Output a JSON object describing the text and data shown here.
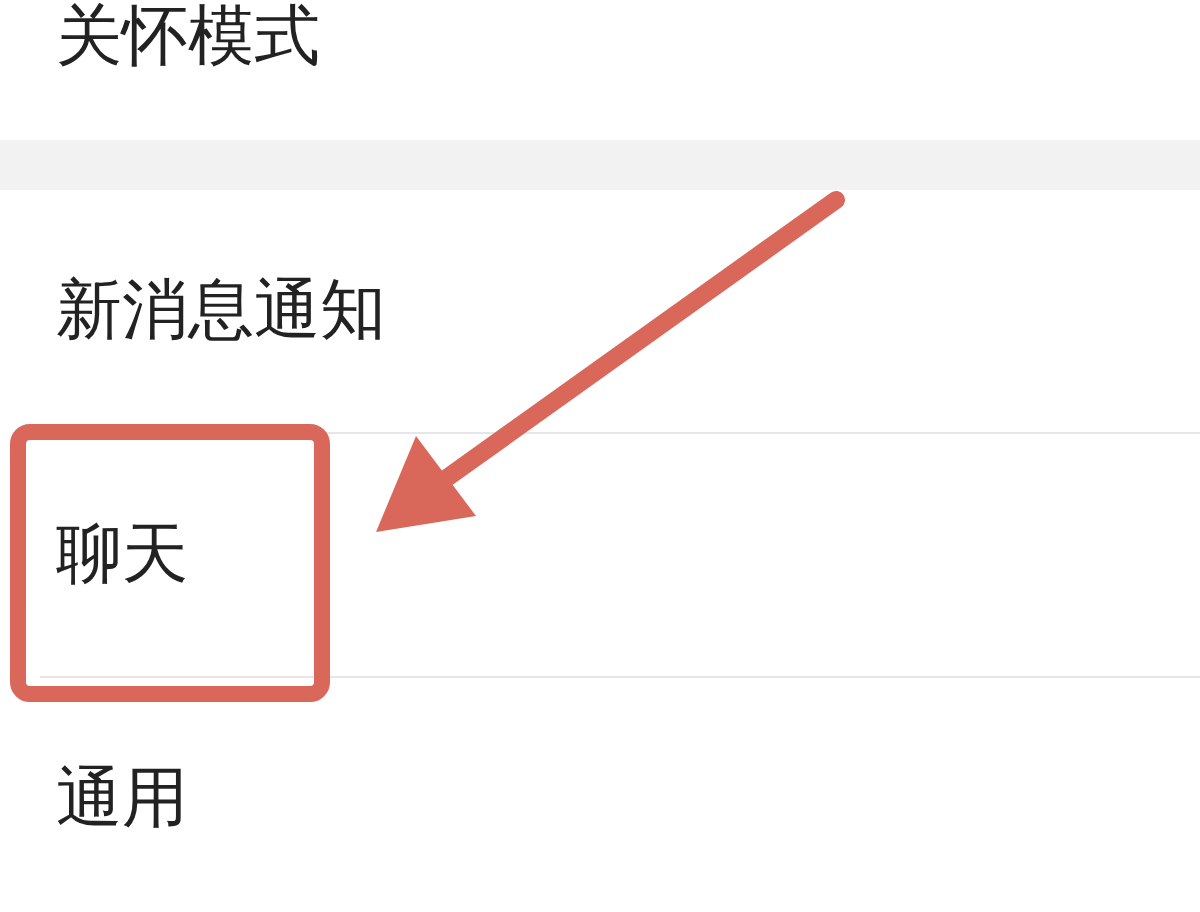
{
  "settings_groups": [
    {
      "items": [
        {
          "label": "关怀模式"
        }
      ]
    },
    {
      "items": [
        {
          "label": "新消息通知"
        },
        {
          "label": "聊天"
        },
        {
          "label": "通用"
        }
      ]
    }
  ]
}
